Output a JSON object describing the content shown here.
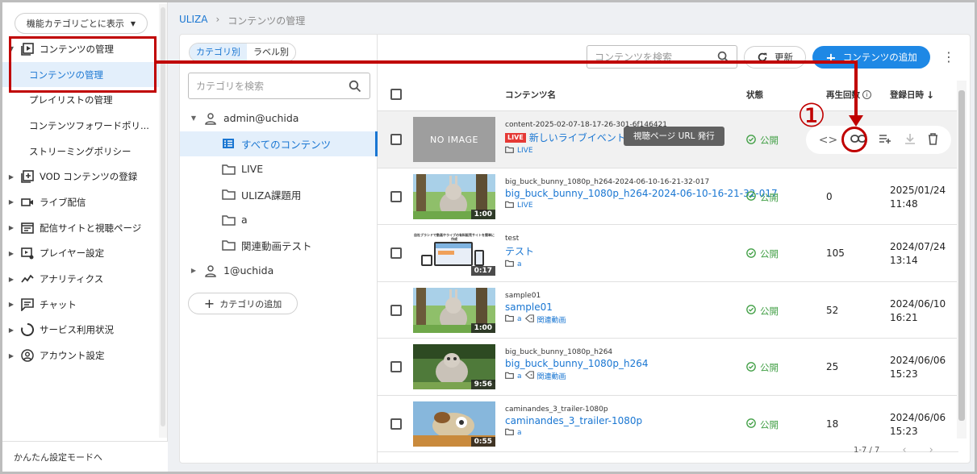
{
  "sidebar": {
    "func_button": "機能カテゴリごとに表示",
    "items": [
      {
        "label": "コンテンツの管理",
        "icon": "video-library-icon",
        "expanded": true
      },
      {
        "label": "コンテンツの管理",
        "sub": true,
        "active": true
      },
      {
        "label": "プレイリストの管理",
        "sub": true
      },
      {
        "label": "コンテンツフォワードポリ...",
        "sub": true
      },
      {
        "label": "ストリーミングポリシー",
        "sub": true
      },
      {
        "label": "VOD コンテンツの登録",
        "icon": "video-add-icon"
      },
      {
        "label": "ライブ配信",
        "icon": "camera-icon"
      },
      {
        "label": "配信サイトと視聴ページ",
        "icon": "web-page-icon"
      },
      {
        "label": "プレイヤー設定",
        "icon": "player-settings-icon"
      },
      {
        "label": "アナリティクス",
        "icon": "analytics-icon"
      },
      {
        "label": "チャット",
        "icon": "chat-icon"
      },
      {
        "label": "サービス利用状況",
        "icon": "usage-icon"
      },
      {
        "label": "アカウント設定",
        "icon": "account-icon"
      }
    ],
    "easy_mode": "かんたん設定モードへ"
  },
  "breadcrumb": {
    "home": "ULIZA",
    "sep": "›",
    "current": "コンテンツの管理"
  },
  "category_panel": {
    "tab_category": "カテゴリ別",
    "tab_label": "ラベル別",
    "search_placeholder": "カテゴリを検索",
    "tree": [
      {
        "label": "admin@uchida",
        "type": "user",
        "expanded": true
      },
      {
        "label": "すべてのコンテンツ",
        "type": "list",
        "selected": true
      },
      {
        "label": "LIVE",
        "type": "folder"
      },
      {
        "label": "ULIZA課題用",
        "type": "folder"
      },
      {
        "label": "a",
        "type": "folder"
      },
      {
        "label": "関連動画テスト",
        "type": "folder"
      },
      {
        "label": "1@uchida",
        "type": "user",
        "expanded": false
      }
    ],
    "add_category": "カテゴリの追加"
  },
  "toolbar": {
    "search_placeholder": "コンテンツを検索",
    "refresh": "更新",
    "add": "コンテンツの追加"
  },
  "table": {
    "headers": {
      "name": "コンテンツ名",
      "status": "状態",
      "plays": "再生回数",
      "date": "登録日時"
    },
    "rows": [
      {
        "id": "content-2025-02-07-18-17-26-301-6f146421",
        "name": "新しいライブイベント",
        "live": "LIVE",
        "folder": "LIVE",
        "tag": "",
        "status": "公開",
        "plays": "",
        "date1": "",
        "date2": "",
        "thumb": "noimage",
        "noimage": "NO IMAGE",
        "duration": ""
      },
      {
        "id": "big_buck_bunny_1080p_h264-2024-06-10-16-21-32-017",
        "name": "big_buck_bunny_1080p_h264-2024-06-10-16-21-32-017",
        "folder": "LIVE",
        "tag": "",
        "status": "公開",
        "plays": "0",
        "date1": "2025/01/24",
        "date2": "11:48",
        "thumb": "bunny",
        "duration": "1:00"
      },
      {
        "id": "test",
        "name": "テスト",
        "folder": "a",
        "tag": "",
        "status": "公開",
        "plays": "105",
        "date1": "2024/07/24",
        "date2": "13:14",
        "thumb": "site",
        "thumb_text": "自社ブランドで動画やライブの有料販売サイトを簡単に作成",
        "duration": "0:17"
      },
      {
        "id": "sample01",
        "name": "sample01",
        "folder": "a",
        "tag": "関連動画",
        "status": "公開",
        "plays": "52",
        "date1": "2024/06/10",
        "date2": "16:21",
        "thumb": "bunny",
        "duration": "1:00"
      },
      {
        "id": "big_buck_bunny_1080p_h264",
        "name": "big_buck_bunny_1080p_h264",
        "folder": "a",
        "tag": "関連動画",
        "status": "公開",
        "plays": "25",
        "date1": "2024/06/06",
        "date2": "15:23",
        "thumb": "bunny2",
        "duration": "9:56"
      },
      {
        "id": "caminandes_3_trailer-1080p",
        "name": "caminandes_3_trailer-1080p",
        "folder": "a",
        "tag": "",
        "status": "公開",
        "plays": "18",
        "date1": "2024/06/06",
        "date2": "15:23",
        "thumb": "llama",
        "duration": "0:55"
      }
    ]
  },
  "tooltip": "視聴ページ URL 発行",
  "pager": {
    "range": "1-7 / 7",
    "prev": "‹",
    "next": "›"
  },
  "annotation": {
    "number": "①",
    "color": "#c00000"
  },
  "colors": {
    "accent": "#1976d2",
    "primary_button": "#1e88e5",
    "public": "#43a047",
    "live": "#e53935"
  }
}
